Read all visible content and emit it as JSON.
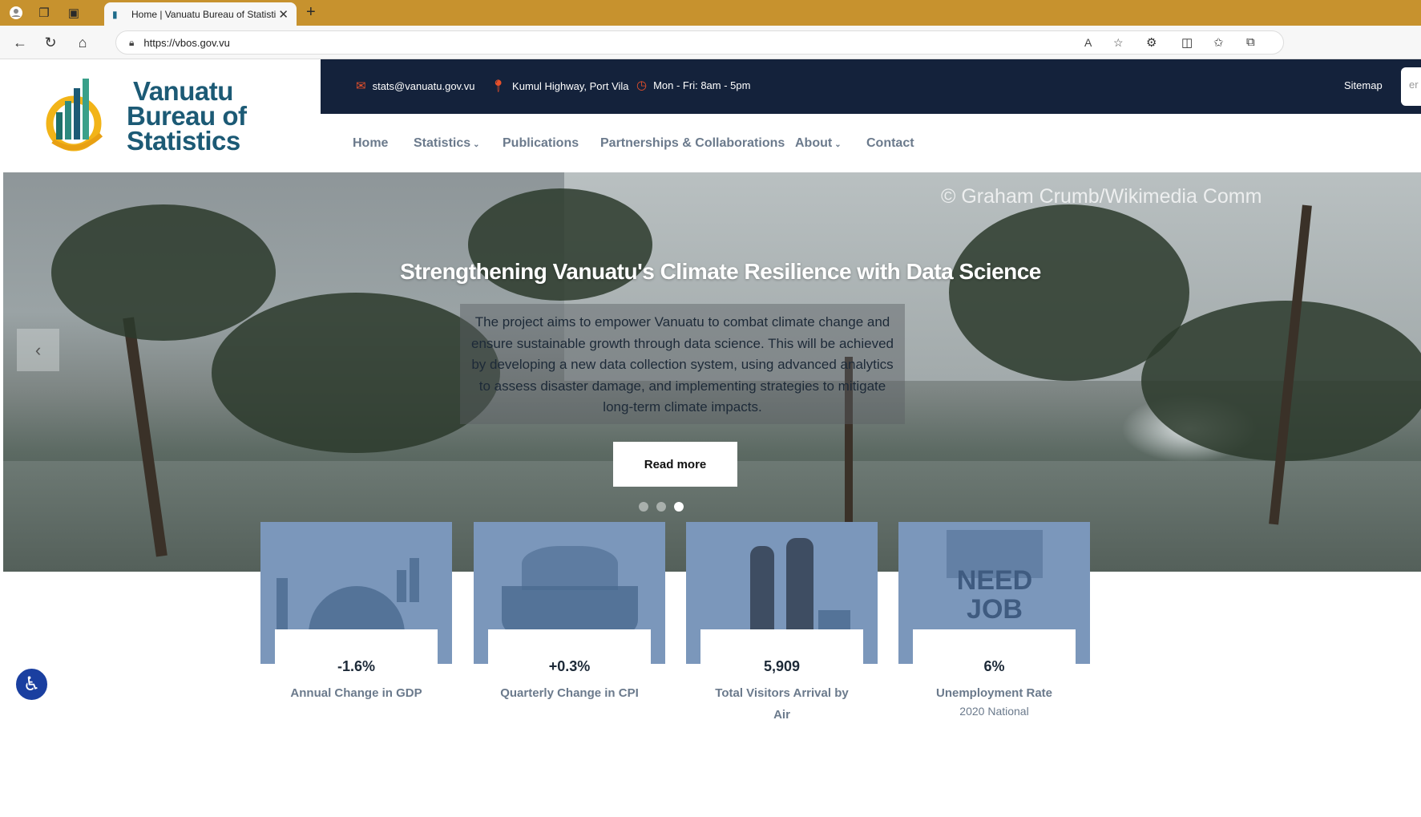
{
  "browser": {
    "tab_title": "Home | Vanuatu Bureau of Statisti",
    "url": "https://vbos.gov.vu"
  },
  "site": {
    "logo_lines": [
      "Vanuatu",
      "Bureau of",
      "Statistics"
    ],
    "topbar": {
      "email": "stats@vanuatu.gov.vu",
      "address": "Kumul Highway, Port Vila",
      "hours": "Mon - Fri: 8am - 5pm",
      "sitemap": "Sitemap",
      "search_stub": "er"
    },
    "nav": [
      "Home",
      "Statistics",
      "Publications",
      "Partnerships & Collaborations",
      "About",
      "Contact"
    ],
    "hero": {
      "credit": "© Graham Crumb/Wikimedia Comm",
      "title": "Strengthening Vanuatu's Climate Resilience with Data Science",
      "description": "The project aims to empower Vanuatu to combat climate change and ensure sustainable growth through data science. This will be achieved by developing a new data collection system, using advanced analytics to assess disaster damage, and implementing strategies to mitigate long-term climate impacts.",
      "button": "Read more",
      "slides": 3,
      "active_slide": 3
    },
    "stats": [
      {
        "value": "-1.6%",
        "label": "Annual Change in GDP",
        "sub": "",
        "icon": "gdp-illustration"
      },
      {
        "value": "+0.3%",
        "label": "Quarterly Change in CPI",
        "sub": "",
        "icon": "basket-illustration"
      },
      {
        "value": "5,909",
        "label": "Total Visitors Arrival by Air",
        "sub": "",
        "icon": "travellers-illustration"
      },
      {
        "value": "6%",
        "label": "Unemployment Rate",
        "sub": "2020 National",
        "icon": "need-job-illustration"
      }
    ]
  },
  "colors": {
    "navy": "#14223b",
    "accent": "#e8502a",
    "logo": "#1c5a75",
    "tab_bar": "#c7922e"
  }
}
